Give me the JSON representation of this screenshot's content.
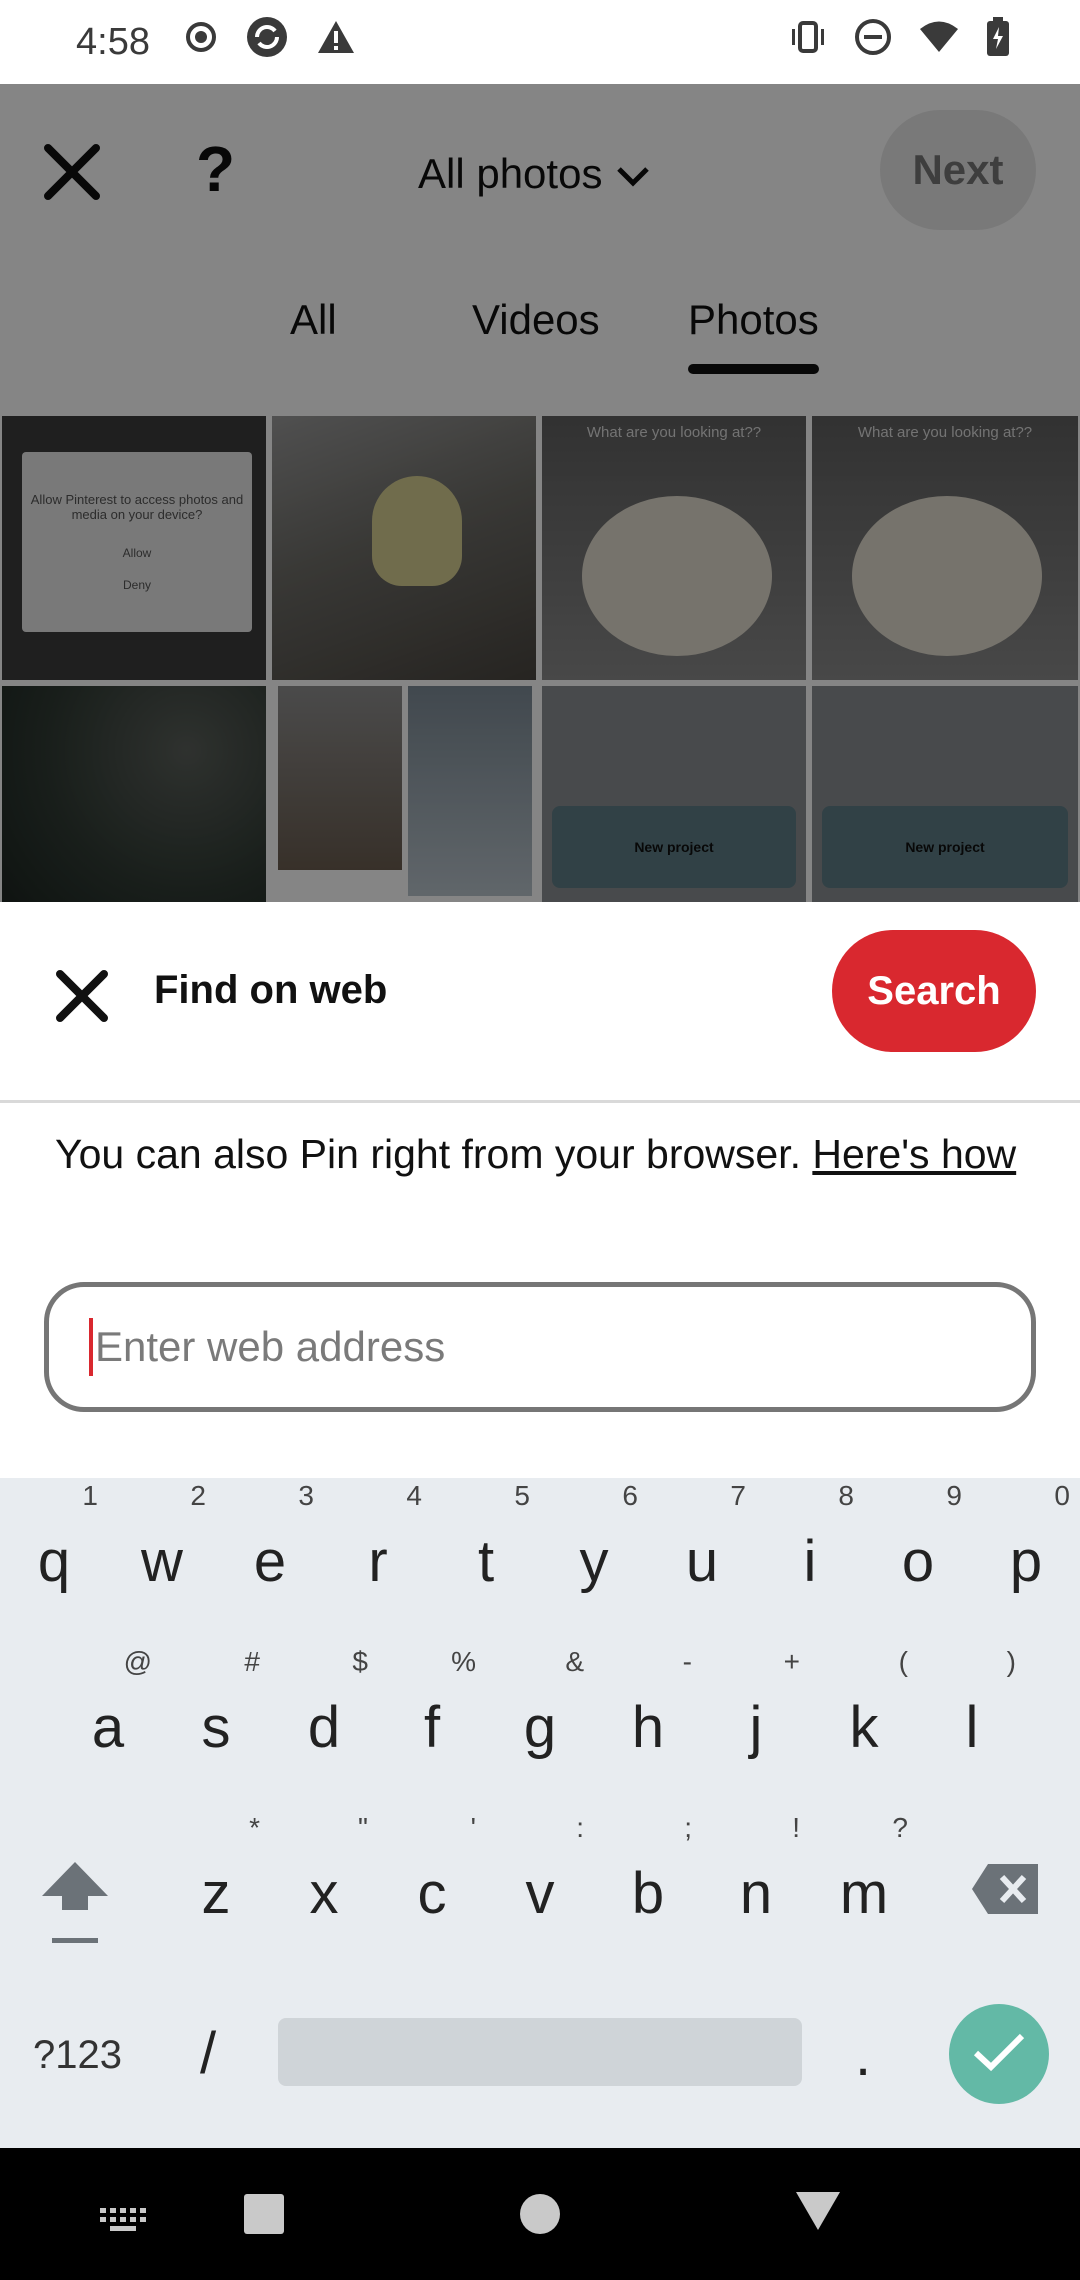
{
  "status_bar": {
    "time": "4:58"
  },
  "background_app": {
    "album_title": "All photos",
    "next_label": "Next",
    "help_label": "?",
    "tabs": [
      {
        "label": "All"
      },
      {
        "label": "Videos"
      },
      {
        "label": "Photos",
        "active": true
      }
    ],
    "tiles": {
      "permission_text": "Allow Pinterest to access photos and media on your device?",
      "permission_allow": "Allow",
      "permission_deny": "Deny",
      "lock_text": "What are you looking at??",
      "new_project": "New project"
    }
  },
  "sheet": {
    "title": "Find on web",
    "search_label": "Search",
    "info_text": "You can also Pin right from your browser. ",
    "info_link": "Here's how",
    "input_placeholder": "Enter web address",
    "input_value": ""
  },
  "keyboard": {
    "row1": [
      {
        "k": "q",
        "s": "1"
      },
      {
        "k": "w",
        "s": "2"
      },
      {
        "k": "e",
        "s": "3"
      },
      {
        "k": "r",
        "s": "4"
      },
      {
        "k": "t",
        "s": "5"
      },
      {
        "k": "y",
        "s": "6"
      },
      {
        "k": "u",
        "s": "7"
      },
      {
        "k": "i",
        "s": "8"
      },
      {
        "k": "o",
        "s": "9"
      },
      {
        "k": "p",
        "s": "0"
      }
    ],
    "row2": [
      {
        "k": "a",
        "s": "@"
      },
      {
        "k": "s",
        "s": "#"
      },
      {
        "k": "d",
        "s": "$"
      },
      {
        "k": "f",
        "s": "%"
      },
      {
        "k": "g",
        "s": "&"
      },
      {
        "k": "h",
        "s": "-"
      },
      {
        "k": "j",
        "s": "+"
      },
      {
        "k": "k",
        "s": "("
      },
      {
        "k": "l",
        "s": ")"
      }
    ],
    "row3": [
      {
        "k": "z",
        "s": "*"
      },
      {
        "k": "x",
        "s": "\""
      },
      {
        "k": "c",
        "s": "'"
      },
      {
        "k": "v",
        "s": ":"
      },
      {
        "k": "b",
        "s": ";"
      },
      {
        "k": "n",
        "s": "!"
      },
      {
        "k": "m",
        "s": "?"
      }
    ],
    "symbols_label": "?123",
    "slash_label": "/",
    "period_label": ".",
    "accent_color": "#63b9a6"
  },
  "colors": {
    "brand_red": "#d9282f"
  }
}
